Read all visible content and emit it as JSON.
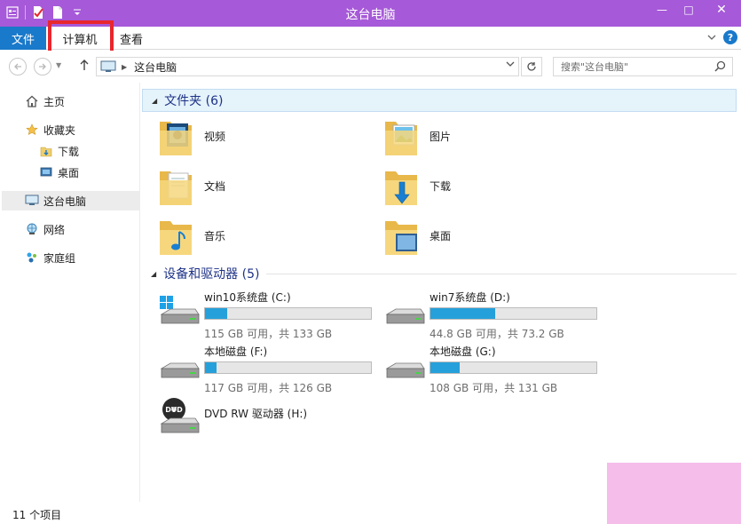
{
  "window": {
    "title": "这台电脑",
    "controls": {
      "minimize": "—",
      "maximize": "□",
      "close": "✕"
    },
    "accent": "#a659d8"
  },
  "ribbon": {
    "file_tab": "文件",
    "tabs": [
      "计算机",
      "查看"
    ],
    "file_color": "#1979ca",
    "highlight_color": "#e8262d",
    "help": "?"
  },
  "address": {
    "crumb": "这台电脑",
    "search_placeholder": "搜索\"这台电脑\""
  },
  "sidebar": {
    "items": [
      {
        "label": "主页",
        "icon": "home-icon"
      },
      {
        "label": "收藏夹",
        "icon": "star-icon"
      },
      {
        "label": "下载",
        "icon": "downloads-folder-icon"
      },
      {
        "label": "桌面",
        "icon": "desktop-icon"
      },
      {
        "label": "这台电脑",
        "icon": "computer-icon",
        "selected": true
      },
      {
        "label": "网络",
        "icon": "network-icon"
      },
      {
        "label": "家庭组",
        "icon": "homegroup-icon"
      }
    ]
  },
  "folders_group": {
    "title": "文件夹 (6)",
    "items": [
      {
        "name": "视频",
        "icon": "videos-folder-icon"
      },
      {
        "name": "图片",
        "icon": "pictures-folder-icon"
      },
      {
        "name": "文档",
        "icon": "documents-folder-icon"
      },
      {
        "name": "下载",
        "icon": "downloads-folder-icon"
      },
      {
        "name": "音乐",
        "icon": "music-folder-icon"
      },
      {
        "name": "桌面",
        "icon": "desktop-folder-icon"
      }
    ]
  },
  "drives_group": {
    "title": "设备和驱动器 (5)",
    "drives": [
      {
        "name": "win10系统盘 (C:)",
        "size": "115 GB 可用，共 133 GB",
        "used_fraction": 0.135,
        "icon": "windows-drive-icon"
      },
      {
        "name": "win7系统盘 (D:)",
        "size": "44.8 GB 可用，共 73.2 GB",
        "used_fraction": 0.388,
        "icon": "hard-drive-icon"
      },
      {
        "name": "本地磁盘 (F:)",
        "size": "117 GB 可用，共 126 GB",
        "used_fraction": 0.071,
        "icon": "hard-drive-icon"
      },
      {
        "name": "本地磁盘 (G:)",
        "size": "108 GB 可用，共 131 GB",
        "used_fraction": 0.176,
        "icon": "hard-drive-icon"
      }
    ],
    "dvd": {
      "name": "DVD RW 驱动器 (H:)",
      "badge": "DVD",
      "icon": "dvd-drive-icon"
    }
  },
  "status": {
    "text": "11 个项目"
  },
  "colors": {
    "group_title": "#1e3287",
    "bar_fill": "#26a0da",
    "sidebar_selected": "#ececec"
  }
}
